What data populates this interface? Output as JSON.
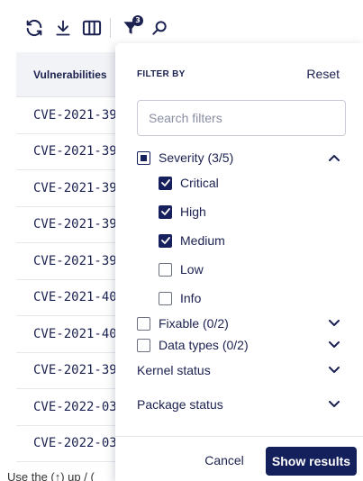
{
  "toolbar": {
    "icons": [
      "refresh-icon",
      "download-icon",
      "columns-icon",
      "filter-icon",
      "search-icon"
    ],
    "filter_badge": "3"
  },
  "table": {
    "header": "Vulnerabilities",
    "rows": [
      "CVE-2021-39",
      "CVE-2021-39",
      "CVE-2021-39",
      "CVE-2021-39",
      "CVE-2021-39",
      "CVE-2021-40",
      "CVE-2021-40",
      "CVE-2021-39",
      "CVE-2022-03",
      "CVE-2022-03"
    ],
    "footnote": "Use the (↑) up / ("
  },
  "filter_panel": {
    "title": "FILTER BY",
    "reset_label": "Reset",
    "search_placeholder": "Search filters",
    "severity": {
      "label": "Severity (3/5)",
      "state": "indeterminate",
      "expanded": true,
      "options": [
        {
          "label": "Critical",
          "checked": true
        },
        {
          "label": "High",
          "checked": true
        },
        {
          "label": "Medium",
          "checked": true
        },
        {
          "label": "Low",
          "checked": false
        },
        {
          "label": "Info",
          "checked": false
        }
      ]
    },
    "fixable": {
      "label": "Fixable (0/2)",
      "checked": false
    },
    "data_types": {
      "label": "Data types (0/2)",
      "checked": false
    },
    "kernel_status": {
      "label": "Kernel status"
    },
    "package_status": {
      "label": "Package status"
    },
    "cancel_label": "Cancel",
    "show_results_label": "Show results"
  },
  "colors": {
    "primary": "#14205c",
    "text": "#1b2150",
    "header_bg": "#f2f3f6"
  }
}
